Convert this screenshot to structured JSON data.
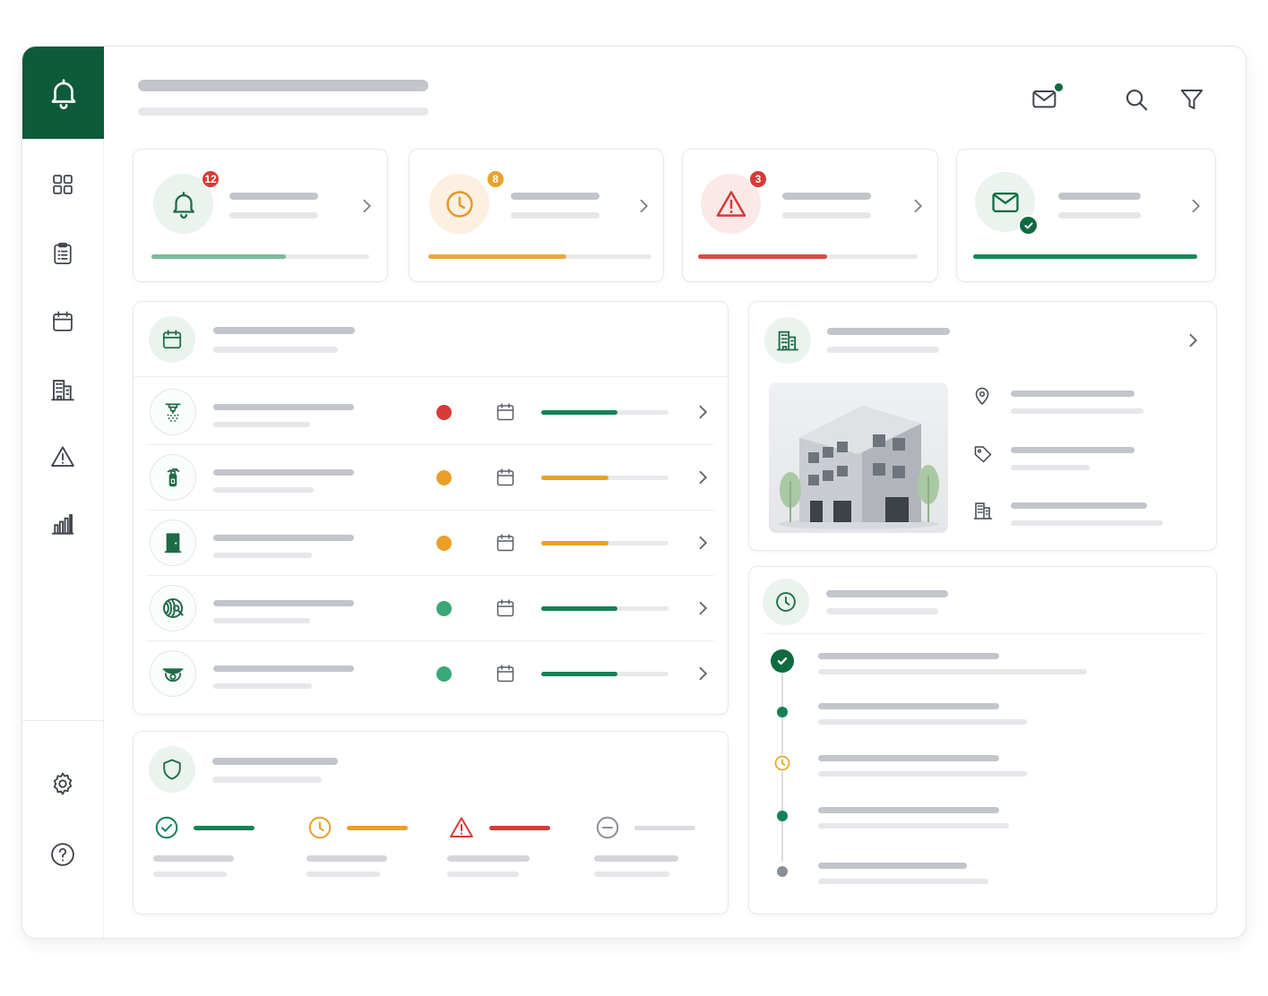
{
  "header": {
    "icons": [
      "mail-icon",
      "search-icon",
      "filter-icon"
    ],
    "mail_unread": true
  },
  "sidebar": {
    "logo_icon": "bell-icon",
    "items": [
      {
        "icon": "grid-icon"
      },
      {
        "icon": "clipboard-icon"
      },
      {
        "icon": "calendar-icon"
      },
      {
        "icon": "building-icon"
      },
      {
        "icon": "warning-icon"
      },
      {
        "icon": "bar-chart-icon"
      }
    ],
    "bottom_items": [
      {
        "icon": "gear-icon"
      },
      {
        "icon": "help-icon"
      }
    ]
  },
  "summary_cards": [
    {
      "icon": "bell-icon",
      "badge": "12",
      "progress": 0.62,
      "color": "#7dbb9c",
      "badge_color": "#d63b36"
    },
    {
      "icon": "clock-icon",
      "badge": "8",
      "progress": 0.62,
      "color": "#e8a93a",
      "badge_color": "#e8a22e"
    },
    {
      "icon": "warning-icon",
      "badge": "3",
      "progress": 0.59,
      "color": "#d94a47",
      "badge_color": "#d63b36"
    },
    {
      "icon": "mail-check-icon",
      "badge": "",
      "progress": 1.0,
      "color": "#148a55",
      "badge_color": "#0f6a40"
    }
  ],
  "equipment_list": {
    "header_icon": "calendar-icon",
    "rows": [
      {
        "icon": "sprinkler-icon",
        "status_color": "#d63b36",
        "progress": 0.6,
        "progress_color": "#148055"
      },
      {
        "icon": "extinguisher-icon",
        "status_color": "#e8a02a",
        "progress": 0.53,
        "progress_color": "#e8a02a"
      },
      {
        "icon": "exit-door-icon",
        "status_color": "#e8a02a",
        "progress": 0.53,
        "progress_color": "#e8a02a"
      },
      {
        "icon": "hose-reel-icon",
        "status_color": "#3aa877",
        "progress": 0.6,
        "progress_color": "#148055"
      },
      {
        "icon": "smoke-detector-icon",
        "status_color": "#3aa877",
        "progress": 0.6,
        "progress_color": "#148055"
      }
    ]
  },
  "compliance": {
    "header_icon": "shield-icon",
    "items": [
      {
        "icon": "check-circle-icon",
        "color": "#148055"
      },
      {
        "icon": "clock-icon",
        "color": "#e8a02a"
      },
      {
        "icon": "warning-icon",
        "color": "#d63b36"
      },
      {
        "icon": "minus-circle-icon",
        "color": "#8a8e96"
      }
    ]
  },
  "building": {
    "header_icon": "building-icon",
    "details": [
      {
        "icon": "location-pin-icon"
      },
      {
        "icon": "tag-icon"
      },
      {
        "icon": "building-icon"
      }
    ]
  },
  "timeline": {
    "header_icon": "clock-icon",
    "events": [
      {
        "marker": "check",
        "color": "#0f6a40"
      },
      {
        "marker": "dot",
        "color": "#148055"
      },
      {
        "marker": "clock",
        "color": "#e8a02a"
      },
      {
        "marker": "dot",
        "color": "#148055"
      },
      {
        "marker": "dot",
        "color": "#8a8e96"
      }
    ]
  },
  "colors": {
    "brand": "#0f5a3a",
    "success": "#148055",
    "warning": "#e8a02a",
    "danger": "#d63b36",
    "muted": "#8a8e96"
  }
}
